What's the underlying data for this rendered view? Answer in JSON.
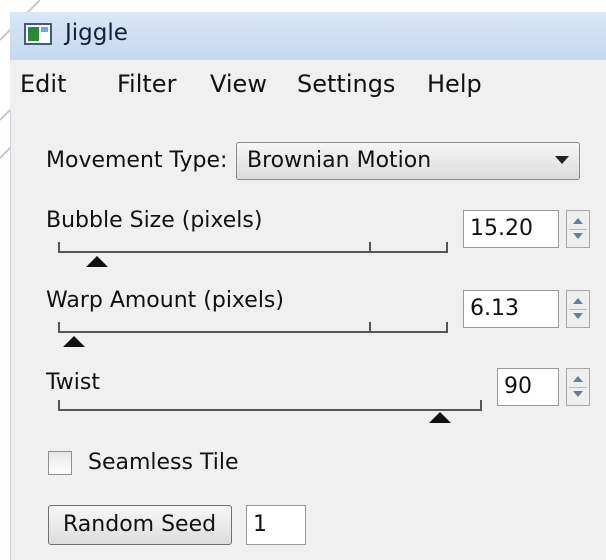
{
  "window": {
    "title": "Jiggle"
  },
  "menu": [
    "Edit",
    "Filter",
    "View",
    "Settings",
    "Help"
  ],
  "movement": {
    "label": "Movement Type:",
    "value": "Brownian Motion"
  },
  "bubble": {
    "label": "Bubble Size (pixels)",
    "value": "15.20",
    "level": 0.1
  },
  "warp": {
    "label": "Warp Amount (pixels)",
    "value": "6.13",
    "level": 0.04
  },
  "twist": {
    "label": "Twist",
    "value": "90",
    "level": 0.9
  },
  "seamless": {
    "label": "Seamless Tile",
    "checked": false
  },
  "seed": {
    "button_label": "Random Seed",
    "value": "1"
  },
  "colors": {
    "titlebar": "#cfe0f3",
    "client": "#f0f0f0",
    "accent_icon": "#2a8a3a"
  },
  "icons": [
    "app-icon",
    "dropdown-arrow-icon",
    "spin-up-icon",
    "spin-down-icon"
  ]
}
